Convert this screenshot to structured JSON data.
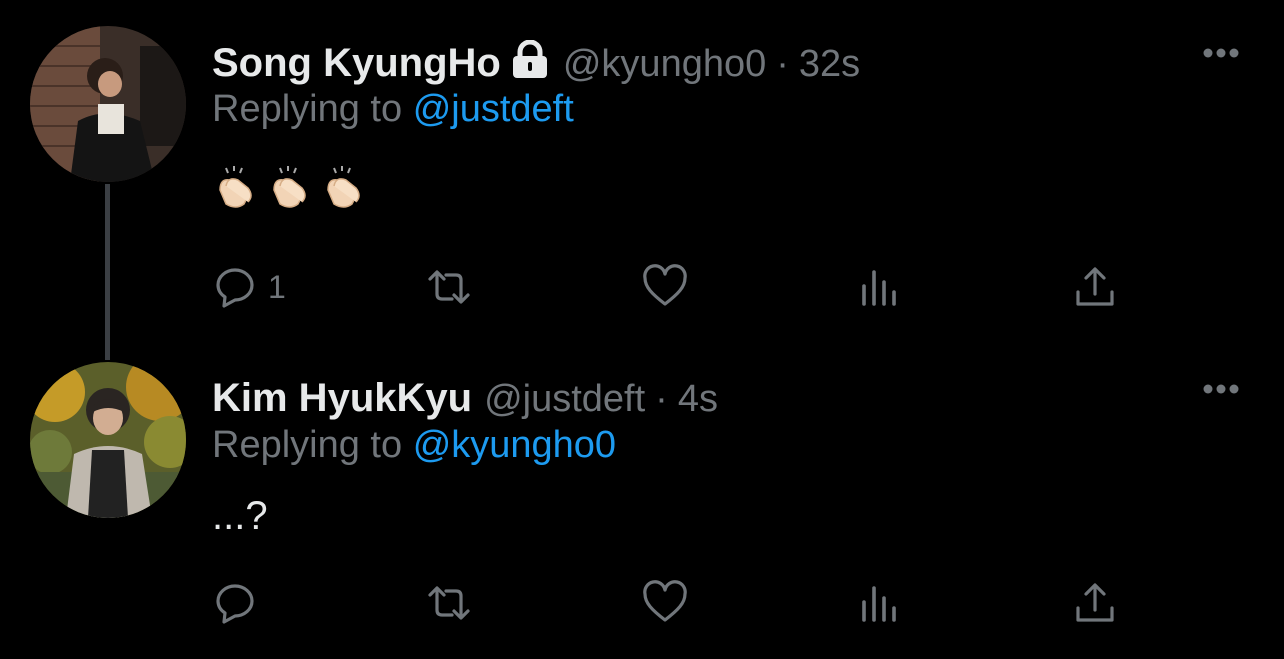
{
  "tweets": [
    {
      "author_name": "Song KyungHo",
      "protected": true,
      "handle": "@kyungho0",
      "separator": "·",
      "time": "32s",
      "replying_prefix": "Replying to",
      "replying_to": "@justdeft",
      "text": "👏🏻👏🏻👏🏻",
      "reply_count": "1"
    },
    {
      "author_name": "Kim HyukKyu",
      "protected": false,
      "handle": "@justdeft",
      "separator": "·",
      "time": "4s",
      "replying_prefix": "Replying to",
      "replying_to": "@kyungho0",
      "text": "...?",
      "reply_count": ""
    }
  ],
  "icons": [
    "lock-icon",
    "more-icon",
    "reply-icon",
    "retweet-icon",
    "like-icon",
    "analytics-icon",
    "share-icon",
    "clap-icon"
  ],
  "colors": {
    "background": "#000000",
    "text": "#e7e9ea",
    "muted": "#71767b",
    "link": "#1d9bf0"
  }
}
